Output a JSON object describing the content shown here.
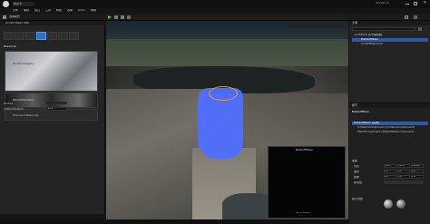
{
  "title": {
    "app": "ue",
    "tab_label": "新关卡",
    "right_label": "Workshop"
  },
  "menu": [
    "文件",
    "编辑",
    "窗口",
    "工具",
    "构建",
    "选择",
    "Actor",
    "帮助"
  ],
  "toolbar": {
    "mode_label": "选择模式",
    "play_icon": "play-icon"
  },
  "left_panel": {
    "header_label": "ArcGIS Maps SDK",
    "section_label": "Basemap",
    "items": [
      "ArcGIS Imagery",
      "World Elevation",
      "Standard Basemap"
    ],
    "fields": [
      "Source",
      "Authentication"
    ],
    "auth_value": "None",
    "accent_color": "#2a6fc8"
  },
  "outliner": {
    "header": "大纲",
    "rows": [
      "(untitled) 关卡编辑器",
      "DefaultPawn",
      "ArcGISMapActor"
    ]
  },
  "details": {
    "header": "细节",
    "selected": "DefaultPawn",
    "components": [
      "DefaultPawn (实例)",
      "CollisionComponent (CollisionComponent)",
      "MeshComponent (StaticMeshComponent)"
    ],
    "rows": [
      "变换",
      "位置",
      "旋转",
      "缩放",
      "移动性"
    ],
    "location_values": [
      "-30.0",
      "-30.0",
      "1000.0"
    ],
    "rotation_values": [
      "0.0",
      "0.0",
      "0.0"
    ],
    "scale_values": [
      "1.0",
      "1.0",
      "1.0"
    ],
    "material_label": "默认材质"
  },
  "viewport": {
    "preview_title": "DefaultPawn",
    "preview_footer": "SC_0000000",
    "highlight_color": "#4f6fff"
  }
}
